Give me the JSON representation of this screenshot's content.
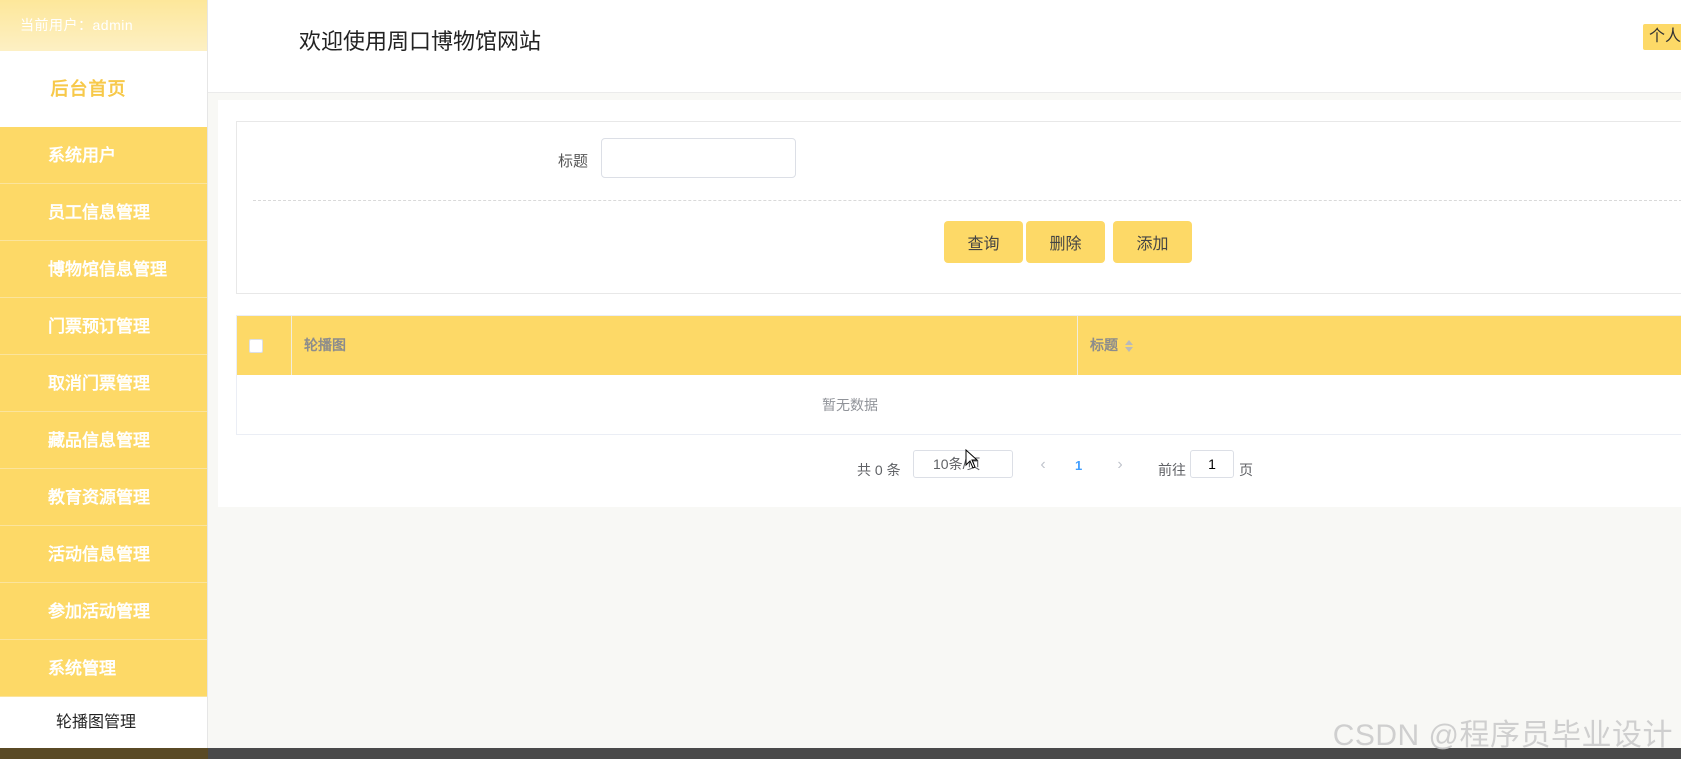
{
  "sidebar": {
    "current_user": "当前用户：admin",
    "home_label": "后台首页",
    "menu": [
      {
        "label": "系统用户"
      },
      {
        "label": "员工信息管理"
      },
      {
        "label": "博物馆信息管理"
      },
      {
        "label": "门票预订管理"
      },
      {
        "label": "取消门票管理"
      },
      {
        "label": "藏品信息管理"
      },
      {
        "label": "教育资源管理"
      },
      {
        "label": "活动信息管理"
      },
      {
        "label": "参加活动管理"
      },
      {
        "label": "系统管理"
      }
    ],
    "submenu_active": "轮播图管理"
  },
  "header": {
    "title": "欢迎使用周口博物馆网站",
    "personal_button": "个人中心"
  },
  "search": {
    "title_label": "标题",
    "title_value": "",
    "buttons": {
      "query": "查询",
      "delete": "删除",
      "add": "添加"
    }
  },
  "table": {
    "columns": [
      "轮播图",
      "标题"
    ],
    "empty_text": "暂无数据"
  },
  "pagination": {
    "total": "共 0 条",
    "page_size": "10条/页",
    "prev_icon": "chevron-left-icon",
    "next_icon": "chevron-right-icon",
    "current_page": "1",
    "goto_label": "前往",
    "goto_value": "1",
    "page_suffix": "页"
  },
  "watermark": "CSDN @程序员毕业设计",
  "colors": {
    "accent": "#fdd967",
    "accent_text": "#f7c94a",
    "link": "#409eff"
  }
}
